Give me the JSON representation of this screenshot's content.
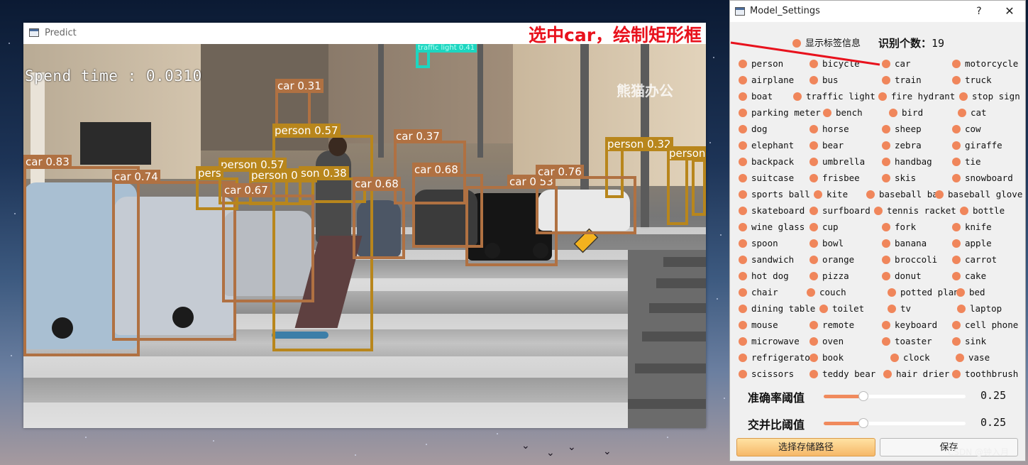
{
  "colors": {
    "accent": "#f0865b",
    "annotation": "#e8121d",
    "box_car": "#b07142",
    "box_person": "#b8861c"
  },
  "predict_window": {
    "title": "Predict",
    "annotation": "选中car，绘制矩形框",
    "spend_time": "Spend time : 0.0310",
    "watermark": "熊猫办公",
    "detections": [
      {
        "label": "car 0.31",
        "kind": "car"
      },
      {
        "label": "person 0.57",
        "kind": "person"
      },
      {
        "label": "car 0.37",
        "kind": "car"
      },
      {
        "label": "person 0.32",
        "kind": "person"
      },
      {
        "label": "person",
        "kind": "person"
      },
      {
        "label": "car 0.83",
        "kind": "car"
      },
      {
        "label": "car 0.74",
        "kind": "car"
      },
      {
        "label": "person 0.57",
        "kind": "person"
      },
      {
        "label": "pers",
        "kind": "person"
      },
      {
        "label": "person 0.58",
        "kind": "person"
      },
      {
        "label": "son 0.38",
        "kind": "person"
      },
      {
        "label": "car 0.67",
        "kind": "car"
      },
      {
        "label": "car 0.68",
        "kind": "car"
      },
      {
        "label": "car 0.68",
        "kind": "car"
      },
      {
        "label": "car 0.53",
        "kind": "car"
      },
      {
        "label": "car 0.76",
        "kind": "car"
      },
      {
        "label": "traffic light 0.41",
        "kind": "light"
      }
    ]
  },
  "settings_window": {
    "title": "Model_Settings",
    "help": "?",
    "close": "✕",
    "show_labels": "显示标签信息",
    "count_label": "识别个数：",
    "count_value": "19",
    "classes": [
      [
        "person",
        "bicycle",
        "car",
        "motorcycle"
      ],
      [
        "airplane",
        "bus",
        "train",
        "truck"
      ],
      [
        "boat",
        "traffic light",
        "fire hydrant",
        "stop sign"
      ],
      [
        "parking meter",
        "bench",
        "bird",
        "cat"
      ],
      [
        "dog",
        "horse",
        "sheep",
        "cow"
      ],
      [
        "elephant",
        "bear",
        "zebra",
        "giraffe"
      ],
      [
        "backpack",
        "umbrella",
        "handbag",
        "tie"
      ],
      [
        "suitcase",
        "frisbee",
        "skis",
        "snowboard"
      ],
      [
        "sports ball",
        "kite",
        "baseball bat",
        "baseball glove"
      ],
      [
        "skateboard",
        "surfboard",
        "tennis racket",
        "bottle"
      ],
      [
        "wine glass",
        "cup",
        "fork",
        "knife"
      ],
      [
        "spoon",
        "bowl",
        "banana",
        "apple"
      ],
      [
        "sandwich",
        "orange",
        "broccoli",
        "carrot"
      ],
      [
        "hot dog",
        "pizza",
        "donut",
        "cake"
      ],
      [
        "chair",
        "couch",
        "potted plant",
        "bed"
      ],
      [
        "dining table",
        "toilet",
        "tv",
        "laptop"
      ],
      [
        "mouse",
        "remote",
        "keyboard",
        "cell phone"
      ],
      [
        "microwave",
        "oven",
        "toaster",
        "sink"
      ],
      [
        "refrigerator",
        "book",
        "clock",
        "vase"
      ],
      [
        "scissors",
        "teddy bear",
        "hair drier",
        "toothbrush"
      ]
    ],
    "confidence": {
      "label": "准确率阈值",
      "value": "0.25",
      "fraction": 0.28
    },
    "iou": {
      "label": "交并比阈值",
      "value": "0.25",
      "fraction": 0.28
    },
    "choose_path_label": "选择存储路径",
    "save_label": "保存"
  },
  "csdn_mark": "CSDN @钟入月"
}
